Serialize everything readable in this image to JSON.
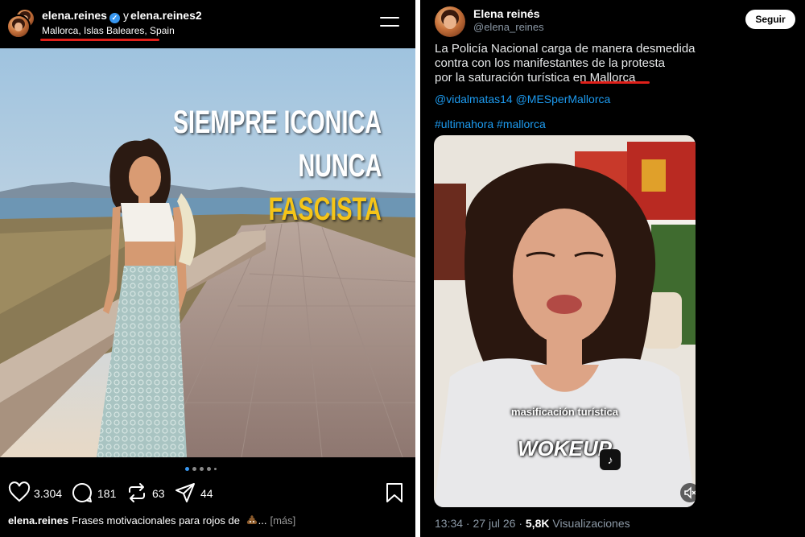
{
  "instagram": {
    "header": {
      "username": "elena.reines",
      "joiner": "y",
      "collaborator": "elena.reines2",
      "location": "Mallorca, Islas Baleares, Spain"
    },
    "overlay": {
      "line1": "SIEMPRE ICONICA",
      "line2": "NUNCA",
      "line3": "FASCISTA",
      "line3_color": "#f5c518"
    },
    "carousel": {
      "total": 5,
      "active": 1
    },
    "actions": {
      "likes": "3.304",
      "comments": "181",
      "reposts": "63",
      "shares": "44"
    },
    "caption": {
      "user": "elena.reines",
      "text": "Frases motivacionales para rojos de",
      "emoji_icon": "poop-emoji-icon",
      "ellipsis": "...",
      "more": "[más]"
    }
  },
  "twitter": {
    "name": "Elena reinés",
    "handle": "@elena_reines",
    "follow_label": "Seguir",
    "text_line1": "La Policía Nacional carga de manera desmedida",
    "text_line2": "contra con los manifestantes de la protesta",
    "text_line3_a": "por la saturación turística ",
    "text_line3_b": "en Mallorca",
    "mentions": "@vidalmatas14 @MESperMallorca",
    "hashtags": "#ultimahora #mallorca",
    "video": {
      "caption_small": "masificación turística",
      "caption_big": "WOKEUP"
    },
    "time": "13:34",
    "date": "27 jul 26",
    "views_count": "5,8K",
    "views_label": "Visualizaciones"
  },
  "colors": {
    "highlight_underline": "#e0201a",
    "link": "#1d9bf0",
    "muted": "#8b98a5",
    "verified": "#3897f0"
  }
}
